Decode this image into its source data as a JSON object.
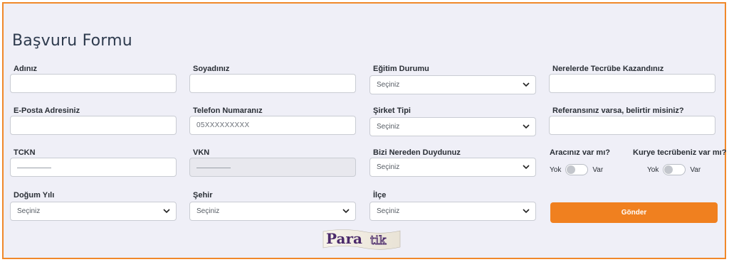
{
  "form": {
    "title": "Başvuru Formu",
    "fields": {
      "adiniz": {
        "label": "Adınız",
        "value": ""
      },
      "soyadiniz": {
        "label": "Soyadınız",
        "value": ""
      },
      "egitim": {
        "label": "Eğitim Durumu",
        "selected": "Seçiniz"
      },
      "tecrube": {
        "label": "Nerelerde Tecrübe Kazandınız",
        "value": ""
      },
      "eposta": {
        "label": "E-Posta Adresiniz",
        "value": ""
      },
      "telefon": {
        "label": "Telefon Numaranız",
        "placeholder": "05XXXXXXXXX"
      },
      "sirket": {
        "label": "Şirket Tipi",
        "selected": "Seçiniz"
      },
      "referans": {
        "label": "Referansınız varsa, belirtir misiniz?",
        "value": ""
      },
      "tckn": {
        "label": "TCKN"
      },
      "vkn": {
        "label": "VKN"
      },
      "duyuru": {
        "label": "Bizi Nereden Duydunuz",
        "selected": "Seçiniz"
      },
      "dogum": {
        "label": "Doğum Yılı",
        "selected": "Seçiniz"
      },
      "sehir": {
        "label": "Şehir",
        "selected": "Seçiniz"
      },
      "ilce": {
        "label": "İlçe",
        "selected": "Seçiniz"
      }
    },
    "toggles": {
      "arac": {
        "label": "Aracınız var mı?",
        "off": "Yok",
        "on": "Var",
        "checked": false
      },
      "kurye": {
        "label": "Kurye tecrübeniz var mı?",
        "off": "Yok",
        "on": "Var",
        "checked": false
      }
    },
    "submit_label": "Gönder"
  },
  "logo": {
    "text_main": "Para",
    "text_accent": "tik"
  },
  "colors": {
    "accent": "#f0801f",
    "border": "#f0882a",
    "background": "#efeff7",
    "logo_purple": "#4b2a6b"
  },
  "icons": {
    "select": "chevron-down-icon"
  }
}
